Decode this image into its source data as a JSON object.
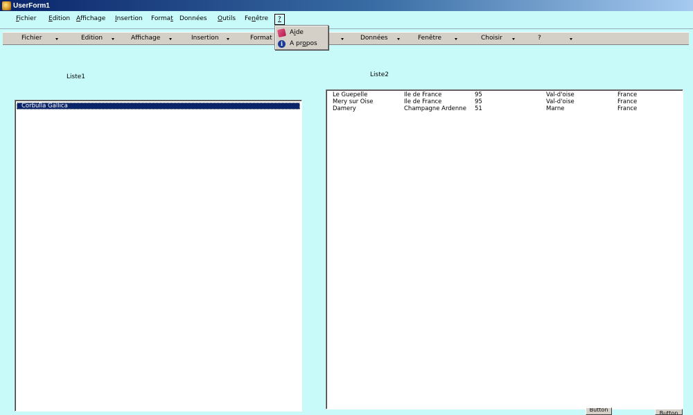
{
  "window": {
    "title": "UserForm1"
  },
  "menubar": [
    {
      "pre": "",
      "u": "F",
      "post": "ichier"
    },
    {
      "pre": "",
      "u": "E",
      "post": "dition"
    },
    {
      "pre": "",
      "u": "A",
      "post": "ffichage"
    },
    {
      "pre": "",
      "u": "I",
      "post": "nsertion"
    },
    {
      "pre": "Forma",
      "u": "t",
      "post": ""
    },
    {
      "pre": "Données",
      "u": "",
      "post": ""
    },
    {
      "pre": "",
      "u": "O",
      "post": "utils"
    },
    {
      "pre": "Fe",
      "u": "n",
      "post": "être"
    },
    {
      "pre": "",
      "u": "?",
      "post": ""
    }
  ],
  "combobar": [
    {
      "label": "Fichier"
    },
    {
      "label": "Edition"
    },
    {
      "label": "Affichage"
    },
    {
      "label": "Insertion"
    },
    {
      "label": "Format"
    },
    {
      "label": ""
    },
    {
      "label": "Données"
    },
    {
      "label": "Fenêtre"
    },
    {
      "label": "Choisir"
    },
    {
      "label": "?"
    }
  ],
  "help_menu": {
    "items": [
      {
        "pre": "A",
        "u": "i",
        "post": "de",
        "icon": "help-book-icon"
      },
      {
        "pre": "A pr",
        "u": "o",
        "post": "pos",
        "icon": "info-icon"
      }
    ]
  },
  "liste1": {
    "label": "Liste1",
    "items": [
      "Corbulla Gallica"
    ]
  },
  "liste2": {
    "label": "Liste2",
    "rows": [
      [
        "Le Guepelle",
        "Ile de France",
        "95",
        "Val-d'oise",
        "France"
      ],
      [
        "Mery sur Oise",
        "Ile de France",
        "95",
        "Val-d'oise",
        "France"
      ],
      [
        "Damery",
        "Champagne Ardenne",
        "51",
        "Marne",
        "France"
      ]
    ]
  },
  "buttons": {
    "b1": "Button",
    "b2": "Button"
  }
}
